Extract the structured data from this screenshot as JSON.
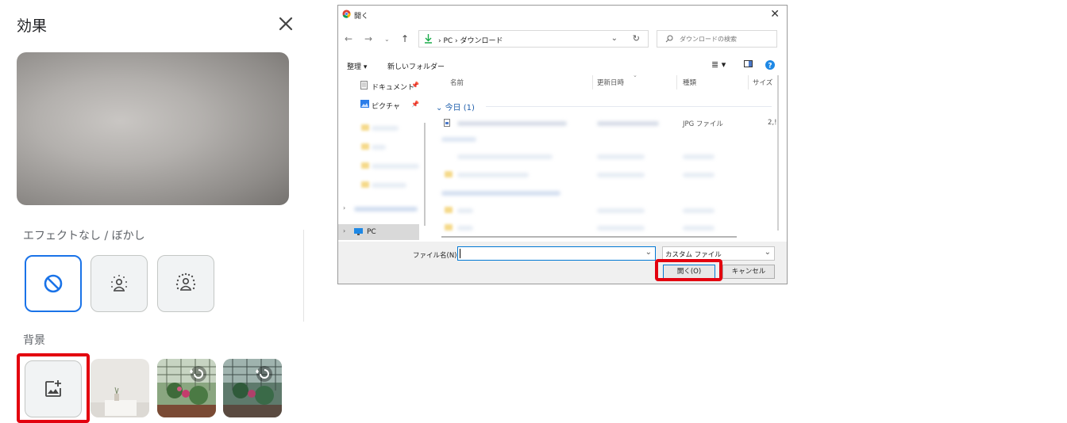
{
  "effects_panel": {
    "title": "効果",
    "blur_section_label": "エフェクトなし / ぼかし",
    "background_section_label": "背景",
    "blur_options": [
      "no-effect",
      "slight-blur",
      "blur"
    ],
    "background_options": [
      "upload-image",
      "minimal-room",
      "greenhouse",
      "greenhouse-dark"
    ]
  },
  "file_dialog": {
    "title": "開く",
    "breadcrumb": [
      "PC",
      "ダウンロード"
    ],
    "search_placeholder": "ダウンロードの検索",
    "toolbar": {
      "organize": "整理 ▾",
      "new_folder": "新しいフォルダー"
    },
    "nav_pane": {
      "documents": "ドキュメント",
      "pictures": "ピクチャ",
      "pc": "PC"
    },
    "columns": {
      "name": "名前",
      "date_modified": "更新日時",
      "type": "種類",
      "size": "サイズ"
    },
    "group_header": "今日 (1)",
    "file_row": {
      "type": "JPG ファイル",
      "size": "2,!"
    },
    "filename_label": "ファイル名(N):",
    "filename_value": "",
    "filetype_select": "カスタム ファイル",
    "open_button": "開く(O)",
    "cancel_button": "キャンセル"
  },
  "colors": {
    "highlight": "#e3000f",
    "selected_border": "#1a73e8",
    "download_arrow": "#1aab4a",
    "pc_icon": "#1e88e5"
  }
}
